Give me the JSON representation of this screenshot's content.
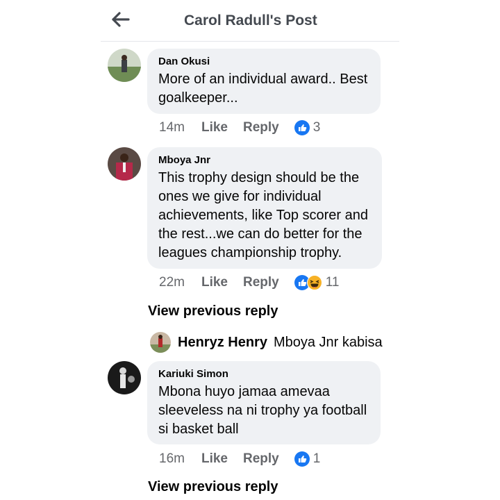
{
  "header": {
    "title": "Carol Radull's Post"
  },
  "comments": [
    {
      "author": "Dan Okusi",
      "lines": [
        "More of an individual award.. Best",
        "goalkeeper..."
      ],
      "time": "14m",
      "like": "Like",
      "reply": "Reply",
      "reactions": "3"
    },
    {
      "author": "Mboya Jnr",
      "lines": [
        "This trophy design should be the",
        "ones we give for individual",
        "achievements, like Top scorer and",
        "the rest...we can do better for the",
        "leagues championship trophy."
      ],
      "time": "22m",
      "like": "Like",
      "reply": "Reply",
      "reactions": "11"
    },
    {
      "author": "Kariuki Simon",
      "lines": [
        "Mbona huyo jamaa amevaa",
        "sleeveless na ni trophy ya football",
        "si basket ball"
      ],
      "time": "16m",
      "like": "Like",
      "reply": "Reply",
      "reactions": "1"
    }
  ],
  "view_previous_reply": "View previous reply",
  "reply_preview": {
    "author": "Henryz Henry",
    "text": "Mboya Jnr kabisa"
  },
  "colors": {
    "like_blue": "#1877f2",
    "haha_yellow": "#f7b125",
    "bubble": "#eff1f4",
    "meta_gray": "#65676b"
  }
}
